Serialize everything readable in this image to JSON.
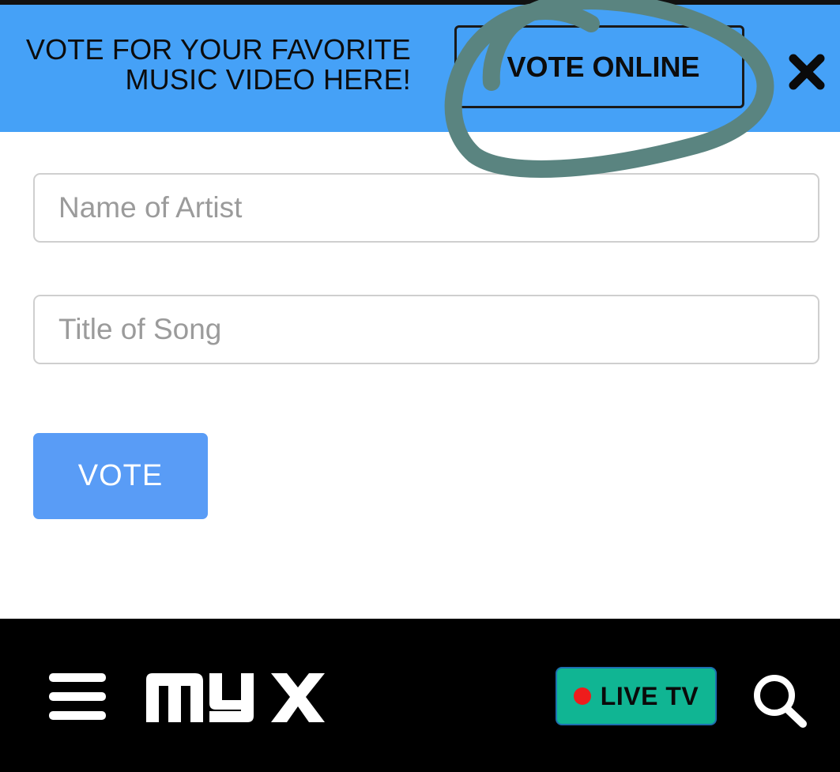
{
  "banner": {
    "line1": "VOTE FOR YOUR FAVORITE",
    "line2": "MUSIC VIDEO HERE!",
    "vote_online_label": "VOTE ONLINE",
    "close_icon": "close-x-icon",
    "background": "#45a1f7"
  },
  "form": {
    "artist_placeholder": "Name of Artist",
    "artist_value": "",
    "song_placeholder": "Title of Song",
    "song_value": "",
    "vote_label": "VOTE",
    "vote_color": "#599cf6"
  },
  "navbar": {
    "menu_icon": "hamburger-menu-icon",
    "logo_text": "myx",
    "live_label": "LIVE TV",
    "live_color": "#10b593",
    "search_icon": "search-icon"
  },
  "annotation": {
    "type": "hand-drawn circle",
    "color": "#5a8480"
  }
}
